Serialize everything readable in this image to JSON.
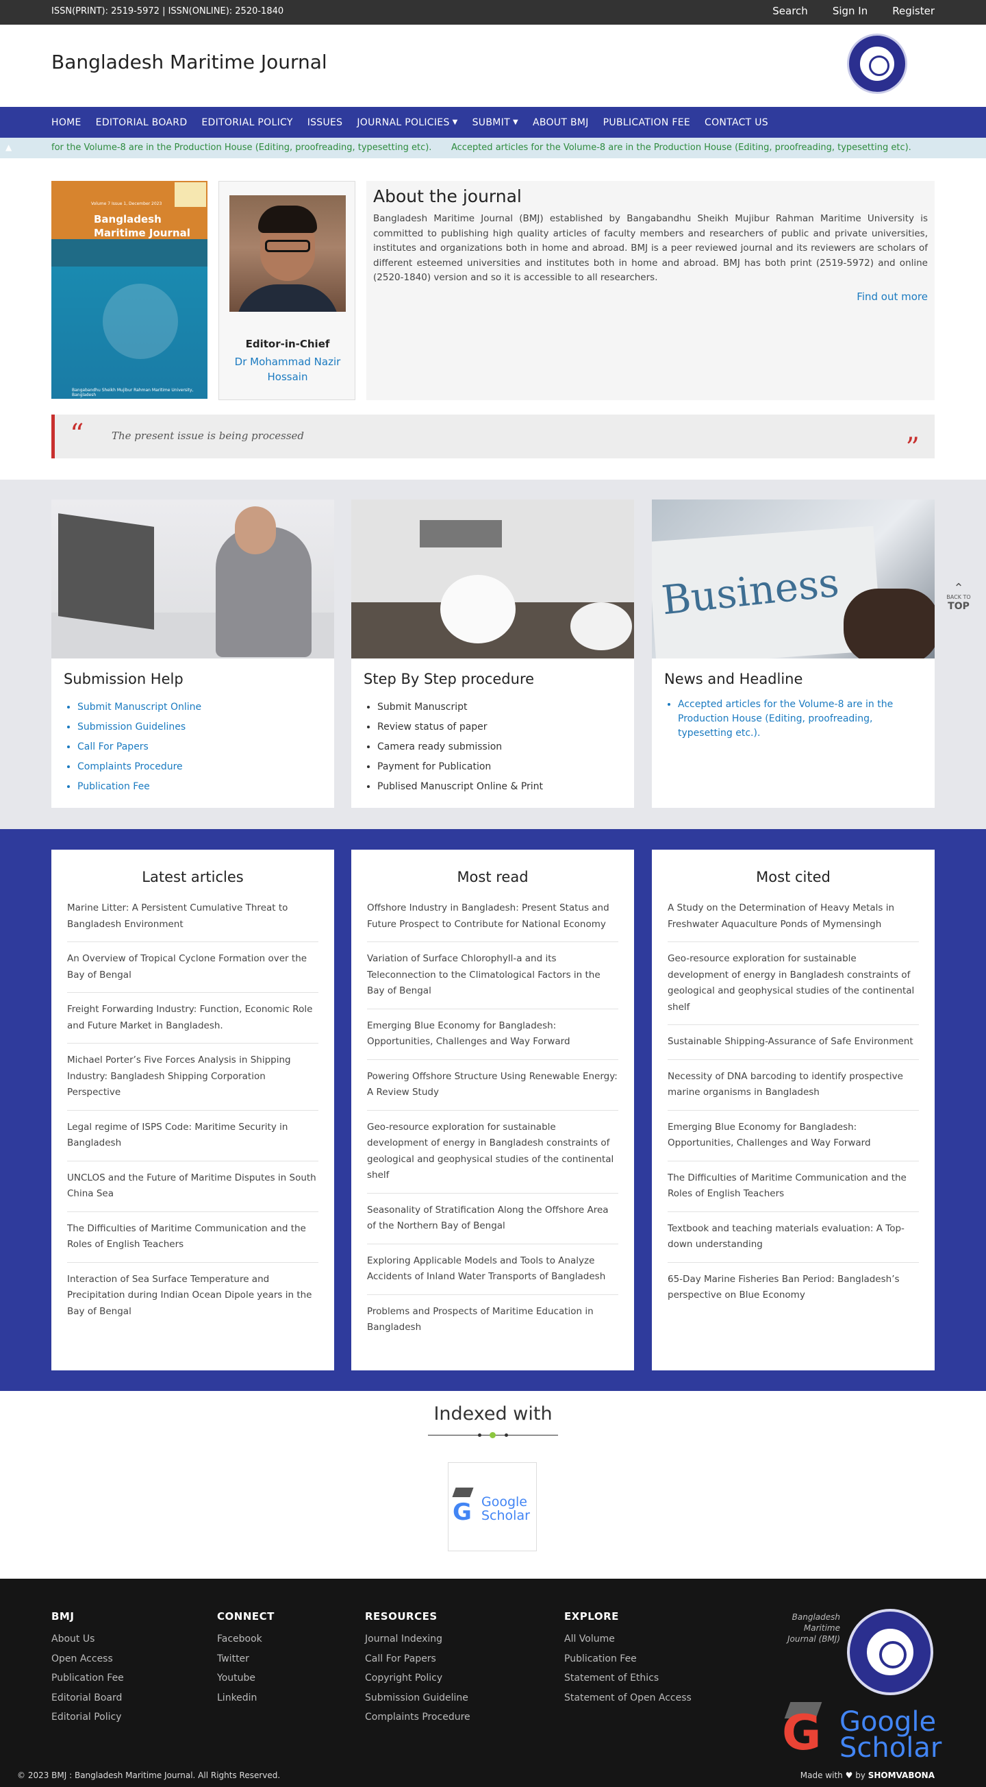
{
  "topbar": {
    "issn": "ISSN(PRINT): 2519-5972 | ISSN(ONLINE): 2520-1840",
    "search": "Search",
    "signin": "Sign In",
    "register": "Register"
  },
  "header": {
    "title": "Bangladesh Maritime Journal"
  },
  "nav": {
    "items": [
      "HOME",
      "EDITORIAL BOARD",
      "EDITORIAL POLICY",
      "ISSUES",
      "JOURNAL POLICIES",
      "SUBMIT",
      "ABOUT BMJ",
      "PUBLICATION FEE",
      "CONTACT US"
    ],
    "caret": "▼"
  },
  "ticker": {
    "partial": "for the Volume-8 are in the Production House (Editing, proofreading, typesetting etc).",
    "full": "Accepted articles for the Volume-8 are in the Production House (Editing, proofreading, typesetting etc)."
  },
  "cover": {
    "title_line1": "Bangladesh",
    "title_line2": "Maritime Journal",
    "volume": "Volume 7 Issue 1, December 2023",
    "footer": "Bangabandhu Sheikh Mujibur Rahman Maritime University, Bangladesh"
  },
  "editor": {
    "role": "Editor-in-Chief",
    "name": "Dr Mohammad Nazir Hossain"
  },
  "about": {
    "heading": "About the journal",
    "text": "Bangladesh Maritime Journal (BMJ) established by Bangabandhu Sheikh Mujibur Rahman Maritime University is committed to publishing high quality articles of faculty members and researchers of public and private universities, institutes and organizations both in home and abroad. BMJ is a peer reviewed journal and its reviewers are scholars of different esteemed universities and institutes both in home and abroad. BMJ has both print (2519-5972) and online (2520-1840) version and so it is accessible to all researchers.",
    "more": "Find out more"
  },
  "quote": {
    "open": "“",
    "close": "”",
    "text": "The present issue is being processed"
  },
  "cards": [
    {
      "title": "Submission Help",
      "items": [
        "Submit Manuscript Online",
        "Submission Guidelines",
        "Call For Papers",
        "Complaints Procedure",
        "Publication Fee"
      ]
    },
    {
      "title": "Step By Step procedure",
      "items": [
        "Submit Manuscript",
        "Review status of paper",
        "Camera ready submission",
        "Payment for Publication",
        "Publised Manuscript Online & Print"
      ]
    },
    {
      "title": "News and Headline",
      "items": [
        "Accepted articles for the Volume-8 are in the Production House (Editing, proofreading, typesetting etc.)."
      ],
      "image_word": "Business"
    }
  ],
  "columns": [
    {
      "title": "Latest articles",
      "items": [
        "Marine Litter: A Persistent Cumulative Threat to Bangladesh Environment",
        "An Overview of Tropical Cyclone Formation over the Bay of Bengal",
        "Freight Forwarding Industry: Function, Economic Role and Future Market in Bangladesh.",
        "Michael Porter’s Five Forces Analysis in Shipping Industry: Bangladesh Shipping Corporation Perspective",
        "Legal regime of ISPS Code: Maritime Security in Bangladesh",
        "UNCLOS and the Future of Maritime Disputes in South China Sea",
        "The Difficulties of Maritime Communication and the Roles of English Teachers",
        "Interaction of Sea Surface Temperature and Precipitation during Indian Ocean Dipole years in the Bay of Bengal"
      ]
    },
    {
      "title": "Most read",
      "items": [
        "Offshore Industry in Bangladesh: Present Status and Future Prospect to Contribute for National Economy",
        "Variation of Surface Chlorophyll-a and its Teleconnection to the Climatological Factors in the Bay of Bengal",
        "Emerging Blue Economy for Bangladesh: Opportunities, Challenges and Way Forward",
        "Powering Offshore Structure Using Renewable Energy: A Review Study",
        "Geo-resource exploration for sustainable development of energy in Bangladesh constraints of geological and geophysical studies of the continental shelf",
        "Seasonality of Stratification Along the Offshore Area of the Northern Bay of Bengal",
        "Exploring Applicable Models and Tools to Analyze Accidents of Inland Water Transports of Bangladesh",
        "Problems and Prospects of Maritime Education in Bangladesh"
      ]
    },
    {
      "title": "Most cited",
      "items": [
        "A Study on the Determination of Heavy Metals in Freshwater Aquaculture Ponds of Mymensingh",
        "Geo-resource exploration for sustainable development of energy in Bangladesh constraints of geological and geophysical studies of the continental shelf",
        "Sustainable Shipping-Assurance of Safe Environment",
        "Necessity of DNA barcoding to identify prospective marine organisms in Bangladesh",
        "Emerging Blue Economy for Bangladesh: Opportunities, Challenges and Way Forward",
        "The Difficulties of Maritime Communication and the Roles of English Teachers",
        "Textbook and teaching materials evaluation: A Top-down understanding",
        "65-Day Marine Fisheries Ban Period: Bangladesh’s perspective on Blue Economy"
      ]
    }
  ],
  "indexed": {
    "heading": "Indexed with",
    "logo_line1": "Google",
    "logo_line2": "Scholar",
    "logo_g": "G"
  },
  "footer": {
    "cols": [
      {
        "title": "BMJ",
        "items": [
          "About Us",
          "Open Access",
          "Publication Fee",
          "Editorial Board",
          "Editorial Policy"
        ]
      },
      {
        "title": "CONNECT",
        "items": [
          "Facebook",
          "Twitter",
          "Youtube",
          "Linkedin"
        ]
      },
      {
        "title": "RESOURCES",
        "items": [
          "Journal Indexing",
          "Call For Papers",
          "Copyright Policy",
          "Submission Guideline",
          "Complaints Procedure"
        ]
      },
      {
        "title": "EXPLORE",
        "items": [
          "All Volume",
          "Publication Fee",
          "Statement of Ethics",
          "Statement of Open Access"
        ]
      }
    ],
    "logo_text": "Bangladesh Maritime Journal (BMJ)",
    "copyright": "© 2023 BMJ : Bangladesh Maritime Journal. All Rights Reserved.",
    "made_with": "Made with",
    "heart": "♥",
    "by": "by",
    "brand": "SHOMVABONA"
  },
  "backtop": {
    "label1": "BACK TO",
    "label2": "TOP"
  }
}
